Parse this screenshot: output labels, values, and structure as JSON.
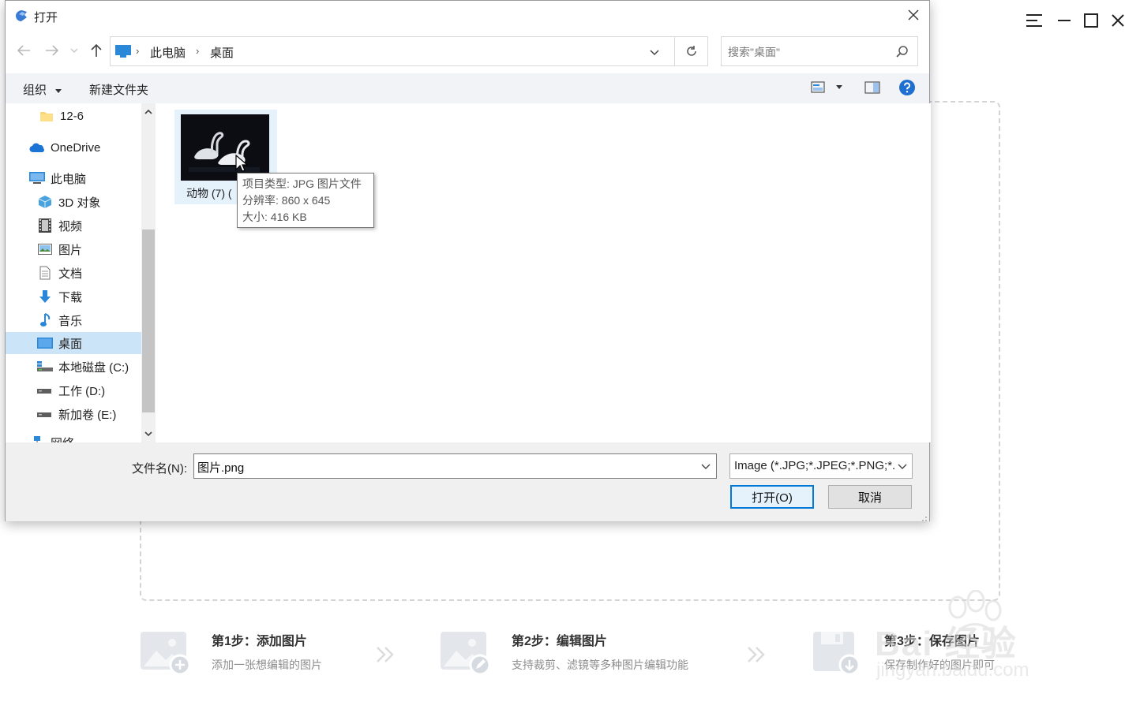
{
  "background_app": {
    "steps": [
      {
        "title": "第1步：添加图片",
        "desc": "添加一张想编辑的图片",
        "icon": "image-add-icon"
      },
      {
        "title": "第2步：编辑图片",
        "desc": "支持裁剪、滤镜等多种图片编辑功能",
        "icon": "image-edit-icon"
      },
      {
        "title": "第3步：保存图片",
        "desc": "保存制作好的图片即可",
        "icon": "save-icon"
      }
    ],
    "window_controls": [
      "menu-icon",
      "minimize-icon",
      "maximize-icon",
      "close-icon"
    ]
  },
  "dialog": {
    "title": "打开",
    "breadcrumbs": [
      "此电脑",
      "桌面"
    ],
    "search_placeholder": "搜索\"桌面\"",
    "toolbar": {
      "organize": "组织",
      "new_folder": "新建文件夹"
    },
    "sidebar": [
      {
        "label": "12-6",
        "icon": "folder-icon",
        "indent": 1
      },
      {
        "label": "OneDrive",
        "icon": "cloud-icon",
        "indent": 0
      },
      {
        "label": "此电脑",
        "icon": "computer-icon",
        "indent": 0
      },
      {
        "label": "3D 对象",
        "icon": "cube-icon",
        "indent": 1
      },
      {
        "label": "视频",
        "icon": "video-icon",
        "indent": 1
      },
      {
        "label": "图片",
        "icon": "pictures-icon",
        "indent": 1
      },
      {
        "label": "文档",
        "icon": "document-icon",
        "indent": 1
      },
      {
        "label": "下载",
        "icon": "download-icon",
        "indent": 1
      },
      {
        "label": "音乐",
        "icon": "music-icon",
        "indent": 1
      },
      {
        "label": "桌面",
        "icon": "desktop-icon",
        "indent": 1,
        "selected": true
      },
      {
        "label": "本地磁盘 (C:)",
        "icon": "drive-c-icon",
        "indent": 1
      },
      {
        "label": "工作 (D:)",
        "icon": "drive-icon",
        "indent": 1
      },
      {
        "label": "新加卷 (E:)",
        "icon": "drive-icon",
        "indent": 1
      },
      {
        "label": "网络",
        "icon": "network-icon",
        "indent": 0
      }
    ],
    "file": {
      "label": "动物 (7) ("
    },
    "tooltip": {
      "type": "项目类型: JPG 图片文件",
      "resolution": "分辨率: 860 x 645",
      "size": "大小: 416 KB"
    },
    "filename_label": "文件名(N):",
    "filename_value": "图片.png",
    "filetype_value": "Image (*.JPG;*.JPEG;*.PNG;*.I",
    "open_button": "打开(O)",
    "cancel_button": "取消",
    "colors": {
      "accent": "#0078d7",
      "selected_bg": "#cce4f7",
      "toolbar_bg": "#f1f3f6"
    }
  },
  "watermark": {
    "line1": "Bai 经验",
    "line2": "jingyan.baidu.com"
  }
}
